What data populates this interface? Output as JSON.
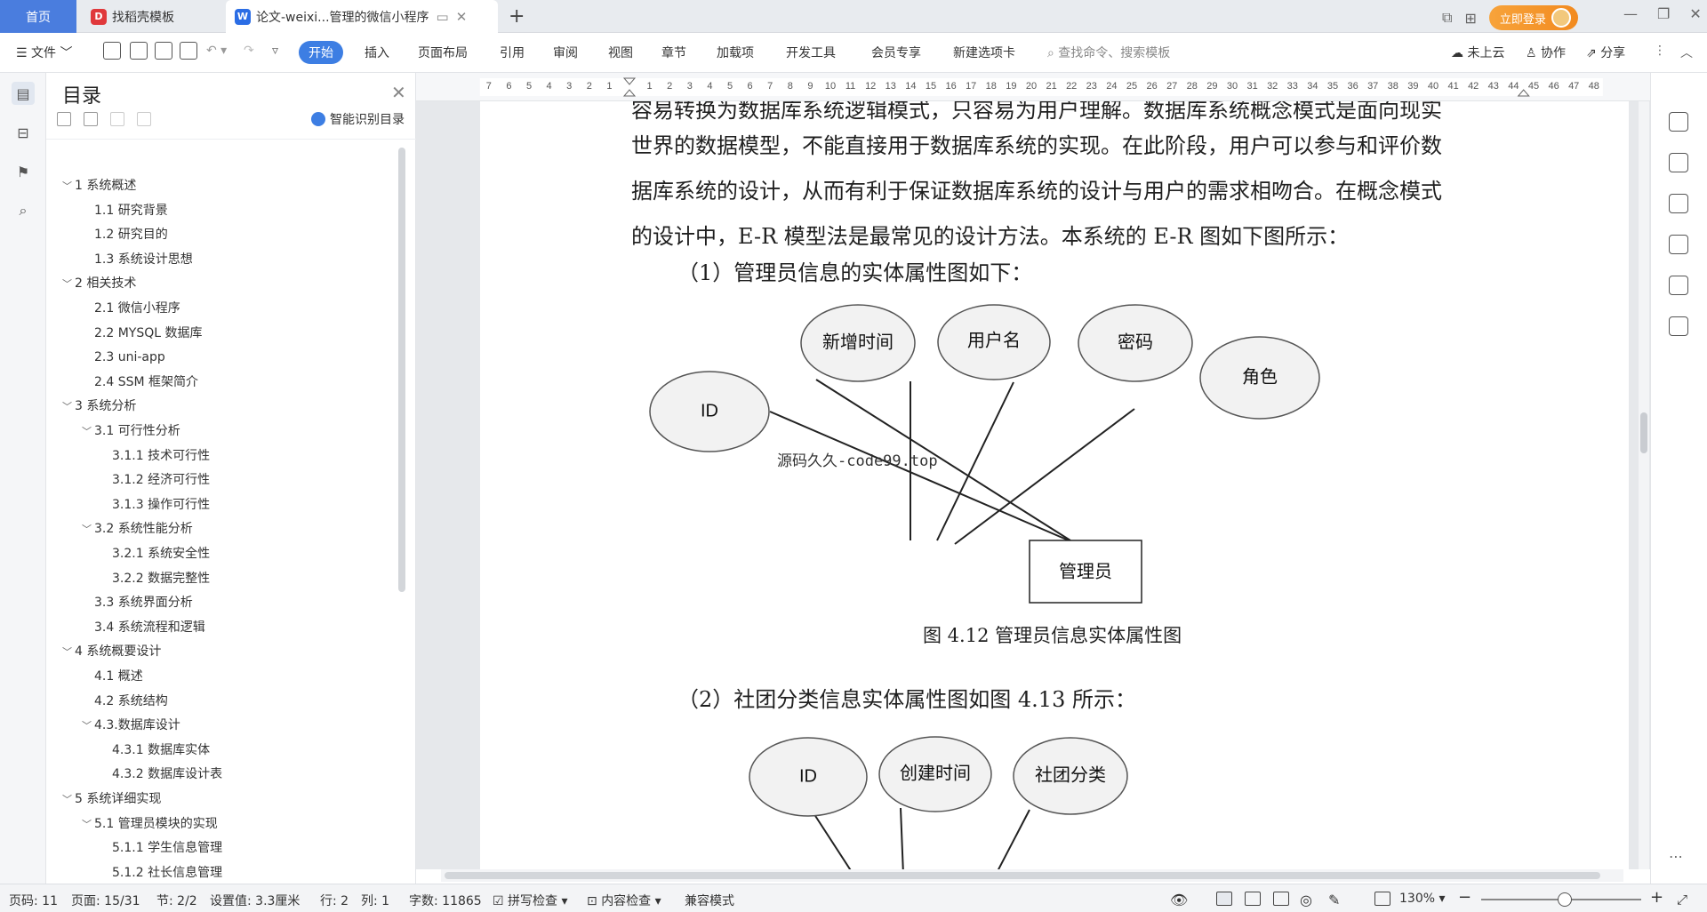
{
  "tabs": {
    "home": "首页",
    "template": "找稻壳模板",
    "document": "论文-weixi...管理的微信小程序"
  },
  "login": "立即登录",
  "menu": {
    "file": "文件",
    "items": [
      "开始",
      "插入",
      "页面布局",
      "引用",
      "审阅",
      "视图",
      "章节",
      "加载项",
      "开发工具",
      "会员专享",
      "新建选项卡"
    ],
    "search_placeholder": "查找命令、搜索模板",
    "cloud": "未上云",
    "collab": "协作",
    "share": "分享"
  },
  "toc": {
    "title": "目录",
    "smart": "智能识别目录",
    "items": [
      {
        "level": 1,
        "text": "1 系统概述",
        "caret": "﹀"
      },
      {
        "level": 2,
        "text": "1.1  研究背景",
        "caret": ""
      },
      {
        "level": 2,
        "text": "1.2 研究目的",
        "caret": ""
      },
      {
        "level": 2,
        "text": "1.3 系统设计思想",
        "caret": ""
      },
      {
        "level": 1,
        "text": "2 相关技术",
        "caret": "﹀"
      },
      {
        "level": 2,
        "text": "2.1 微信小程序",
        "caret": ""
      },
      {
        "level": 2,
        "text": "2.2 MYSQL 数据库",
        "caret": ""
      },
      {
        "level": 2,
        "text": "2.3 uni-app",
        "caret": ""
      },
      {
        "level": 2,
        "text": "2.4 SSM 框架简介",
        "caret": ""
      },
      {
        "level": 1,
        "text": "3 系统分析",
        "caret": "﹀"
      },
      {
        "level": 2,
        "text": "3.1 可行性分析",
        "caret": "﹀"
      },
      {
        "level": 3,
        "text": "3.1.1 技术可行性",
        "caret": ""
      },
      {
        "level": 3,
        "text": "3.1.2 经济可行性",
        "caret": ""
      },
      {
        "level": 3,
        "text": "3.1.3 操作可行性",
        "caret": ""
      },
      {
        "level": 2,
        "text": "3.2 系统性能分析",
        "caret": "﹀"
      },
      {
        "level": 3,
        "text": "3.2.1  系统安全性",
        "caret": ""
      },
      {
        "level": 3,
        "text": "3.2.2  数据完整性",
        "caret": ""
      },
      {
        "level": 2,
        "text": "3.3 系统界面分析",
        "caret": ""
      },
      {
        "level": 2,
        "text": "3.4 系统流程和逻辑",
        "caret": ""
      },
      {
        "level": 1,
        "text": "4 系统概要设计",
        "caret": "﹀"
      },
      {
        "level": 2,
        "text": "4.1 概述",
        "caret": ""
      },
      {
        "level": 2,
        "text": "4.2 系统结构",
        "caret": ""
      },
      {
        "level": 2,
        "text": "4.3.数据库设计",
        "caret": "﹀"
      },
      {
        "level": 3,
        "text": "4.3.1 数据库实体",
        "caret": ""
      },
      {
        "level": 3,
        "text": "4.3.2 数据库设计表",
        "caret": ""
      },
      {
        "level": 1,
        "text": "5 系统详细实现",
        "caret": "﹀"
      },
      {
        "level": 2,
        "text": "5.1  管理员模块的实现",
        "caret": "﹀"
      },
      {
        "level": 3,
        "text": "5.1.1  学生信息管理",
        "caret": ""
      },
      {
        "level": 3,
        "text": "5.1.2  社长信息管理",
        "caret": ""
      }
    ]
  },
  "ruler": {
    "left_ticks": [
      "7",
      "6",
      "5",
      "4",
      "3",
      "2",
      "1"
    ],
    "right_ticks": [
      "1",
      "2",
      "3",
      "4",
      "5",
      "6",
      "7",
      "8",
      "9",
      "10",
      "11",
      "12",
      "13",
      "14",
      "15",
      "16",
      "17",
      "18",
      "19",
      "20",
      "21",
      "22",
      "23",
      "24",
      "25",
      "26",
      "27",
      "28",
      "29",
      "30",
      "31",
      "32",
      "33",
      "34",
      "35",
      "36",
      "37",
      "38",
      "39",
      "40",
      "41",
      "42",
      "43",
      "44",
      "45",
      "46",
      "47",
      "48"
    ]
  },
  "document": {
    "line0": "容易转换为数据库系统逻辑模式，只容易为用户理解。数据库系统概念模式是面向现实",
    "line1": "世界的数据模型，不能直接用于数据库系统的实现。在此阶段，用户可以参与和评价数",
    "line2": "据库系统的设计，从而有利于保证数据库系统的设计与用户的需求相吻合。在概念模式",
    "line3": "的设计中，E-R 模型法是最常见的设计方法。本系统的 E-R 图如下图所示：",
    "heading1": "（1）管理员信息的实体属性图如下：",
    "diagram1": {
      "entity": "管理员",
      "attributes": [
        "ID",
        "新增时间",
        "用户名",
        "密码",
        "角色"
      ],
      "watermark": "源码久久-code99.top"
    },
    "caption1": "图 4.12   管理员信息实体属性图",
    "heading2": "（2）社团分类信息实体属性图如图 4.13 所示：",
    "diagram2": {
      "attributes": [
        "ID",
        "创建时间",
        "社团分类"
      ]
    }
  },
  "status": {
    "page_no": "页码: 11",
    "pages": "页面: 15/31",
    "section": "节: 2/2",
    "setting": "设置值: 3.3厘米",
    "row": "行: 2",
    "col": "列: 1",
    "words": "字数: 11865",
    "spell": "拼写检查",
    "content": "内容检查",
    "compat": "兼容模式",
    "zoom": "130%"
  }
}
